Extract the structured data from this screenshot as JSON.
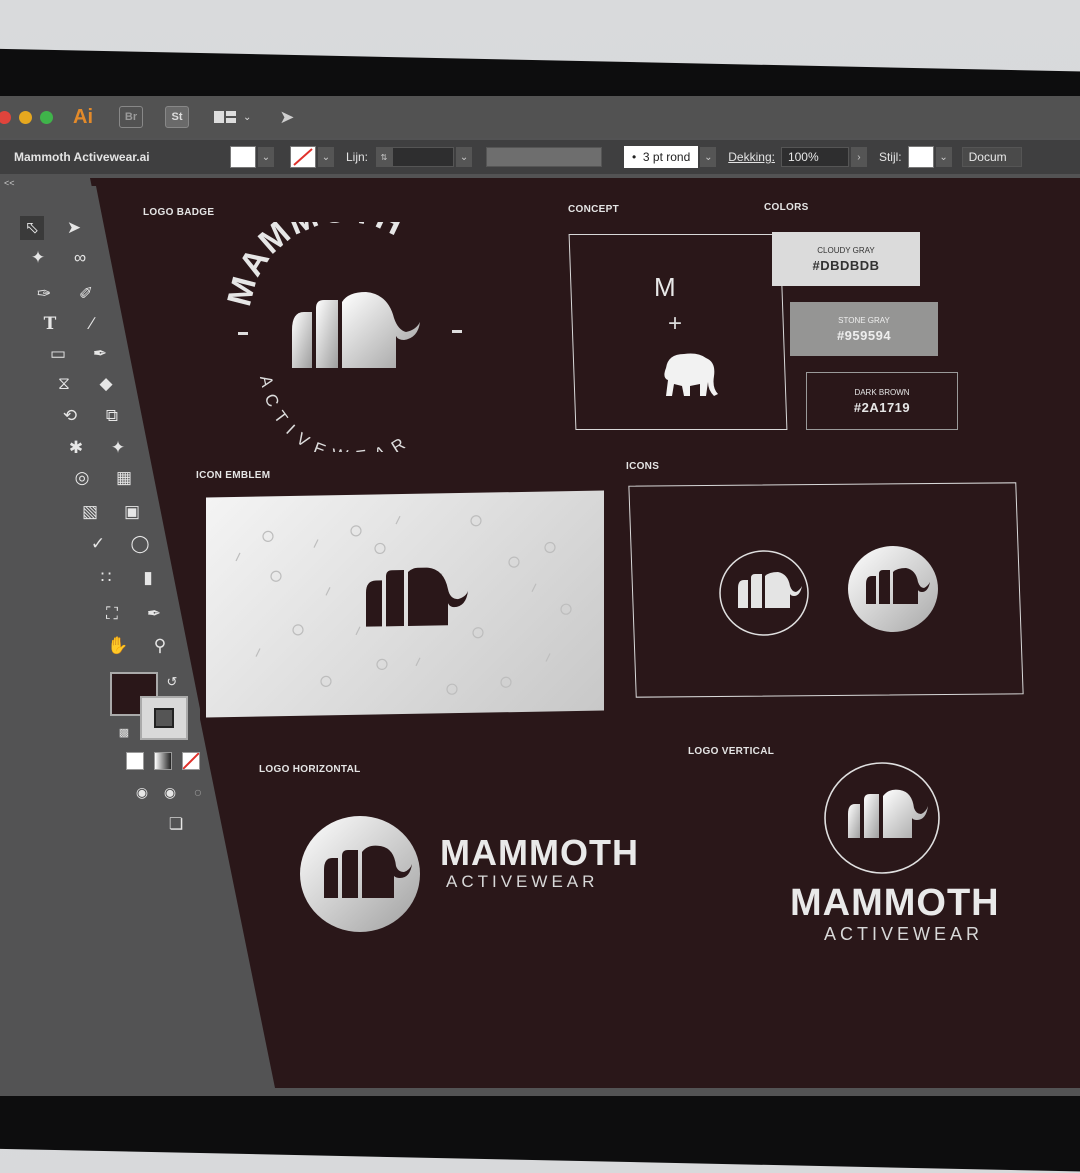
{
  "window": {
    "app_label": "Ai",
    "apps": [
      "Br",
      "St"
    ]
  },
  "control_bar": {
    "document_name": "Mammoth Activewear.ai",
    "stroke_label": "Lijn:",
    "brush_value": "3 pt rond",
    "opacity_label": "Dekking:",
    "opacity_value": "100%",
    "style_label": "Stijl:",
    "doc_button": "Docum"
  },
  "toolbar": {
    "collapse": "<<",
    "title": "",
    "fill_color": "#2A1719",
    "stroke_color": "#DBDBDB"
  },
  "artboard": {
    "logo_badge": {
      "label": "LOGO BADGE",
      "arc_text": "MAMMOTH",
      "sub_text": "ACTIVEWEAR"
    },
    "concept": {
      "label": "CONCEPT",
      "letter": "M",
      "plus": "+"
    },
    "colors": {
      "label": "COLORS",
      "swatches": [
        {
          "name": "CLOUDY GRAY",
          "hex": "#DBDBDB"
        },
        {
          "name": "STONE GRAY",
          "hex": "#959594"
        },
        {
          "name": "DARK BROWN",
          "hex": "#2A1719"
        }
      ]
    },
    "icon_emblem": {
      "label": "ICON EMBLEM"
    },
    "icons": {
      "label": "ICONS"
    },
    "logo_horizontal": {
      "label": "LOGO HORIZONTAL",
      "title": "MAMMOTH",
      "sub": "ACTIVEWEAR"
    },
    "logo_vertical": {
      "label": "LOGO VERTICAL",
      "title": "MAMMOTH",
      "sub": "ACTIVEWEAR"
    }
  }
}
